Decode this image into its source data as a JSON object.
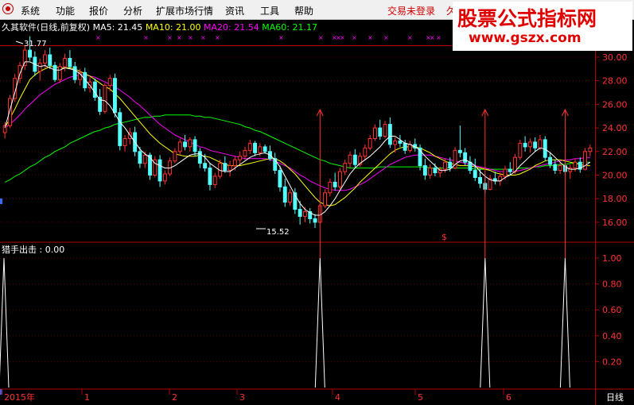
{
  "menu": {
    "items": [
      "系统",
      "功能",
      "报价",
      "分析",
      "扩展市场行情",
      "资讯",
      "工具",
      "帮助"
    ],
    "status": "交易未登录",
    "status_extra": "久"
  },
  "watermark": {
    "title": "股票公式指标网",
    "url": "www.gszx.com"
  },
  "price_panel": {
    "name": "久其软件(日线,前复权)",
    "ma5": "MA5: 21.45",
    "ma10": "MA10: 21.00",
    "ma20": "MA20: 21.54",
    "ma60": "MA60: 21.17",
    "high_label": "31.77",
    "low_label": "15.52",
    "marker": "$",
    "y_ticks": [
      "30.00",
      "28.00",
      "26.00",
      "24.00",
      "22.00",
      "20.00",
      "18.00",
      "16.00"
    ],
    "colors": {
      "ma5": "#ffffff",
      "ma10": "#ffff00",
      "ma20": "#ff00ff",
      "ma60": "#00ff00",
      "up": "#ff3232",
      "down": "#54ffff",
      "signal": "#ff3232"
    }
  },
  "indicator_panel": {
    "title": "猎手出击 : 0.00",
    "y_ticks": [
      "1.00",
      "0.80",
      "0.60",
      "0.40",
      "0.20"
    ]
  },
  "time_axis": {
    "labels": [
      "2015年",
      "1",
      "2",
      "3",
      "4",
      "5",
      "6"
    ],
    "period": "日线"
  },
  "chart_data": {
    "type": "candlestick",
    "ylim": [
      15,
      31.5
    ],
    "candles": [
      [
        23.6,
        24.5,
        23.1,
        24.2
      ],
      [
        24.2,
        26.8,
        24.0,
        26.5
      ],
      [
        26.5,
        28.6,
        26.2,
        28.2
      ],
      [
        28.2,
        29.6,
        27.8,
        29.3
      ],
      [
        29.3,
        31.0,
        28.9,
        30.6
      ],
      [
        30.6,
        31.77,
        29.7,
        30.0
      ],
      [
        30.0,
        30.5,
        28.4,
        28.8
      ],
      [
        28.8,
        29.9,
        28.0,
        29.5
      ],
      [
        29.5,
        30.6,
        29.1,
        30.2
      ],
      [
        30.2,
        30.8,
        29.0,
        29.3
      ],
      [
        29.3,
        29.6,
        27.9,
        28.1
      ],
      [
        28.1,
        29.5,
        27.8,
        29.2
      ],
      [
        29.2,
        30.3,
        28.8,
        29.9
      ],
      [
        29.9,
        30.6,
        29.0,
        29.2
      ],
      [
        29.2,
        29.6,
        27.8,
        28.1
      ],
      [
        28.1,
        29.0,
        27.6,
        28.7
      ],
      [
        28.7,
        29.1,
        27.1,
        27.4
      ],
      [
        27.4,
        28.3,
        27.0,
        27.9
      ],
      [
        27.9,
        28.2,
        26.3,
        26.6
      ],
      [
        26.6,
        27.3,
        25.1,
        25.4
      ],
      [
        25.4,
        27.8,
        25.2,
        27.6
      ],
      [
        27.6,
        28.5,
        27.1,
        28.2
      ],
      [
        28.2,
        28.6,
        24.9,
        25.3
      ],
      [
        25.3,
        25.7,
        22.1,
        22.5
      ],
      [
        22.5,
        23.4,
        22.0,
        23.1
      ],
      [
        23.1,
        24.0,
        22.6,
        23.6
      ],
      [
        23.6,
        24.1,
        21.6,
        22.0
      ],
      [
        22.0,
        22.4,
        20.6,
        21.0
      ],
      [
        21.0,
        22.0,
        20.6,
        21.7
      ],
      [
        21.7,
        21.9,
        19.6,
        20.0
      ],
      [
        20.0,
        21.6,
        19.8,
        21.3
      ],
      [
        21.3,
        21.7,
        19.0,
        19.5
      ],
      [
        19.5,
        20.4,
        19.2,
        20.1
      ],
      [
        20.1,
        21.5,
        19.9,
        21.2
      ],
      [
        21.2,
        22.3,
        21.0,
        22.0
      ],
      [
        22.0,
        23.1,
        21.7,
        22.8
      ],
      [
        22.8,
        23.4,
        22.1,
        22.4
      ],
      [
        22.4,
        23.2,
        22.0,
        23.0
      ],
      [
        23.0,
        23.3,
        21.6,
        22.0
      ],
      [
        22.0,
        22.3,
        20.6,
        21.0
      ],
      [
        21.0,
        21.8,
        20.3,
        20.6
      ],
      [
        20.6,
        21.0,
        18.7,
        19.2
      ],
      [
        19.2,
        20.2,
        18.9,
        19.9
      ],
      [
        19.9,
        21.3,
        19.7,
        21.0
      ],
      [
        21.0,
        21.6,
        20.2,
        20.4
      ],
      [
        20.4,
        21.2,
        19.9,
        20.8
      ],
      [
        20.8,
        21.6,
        20.4,
        21.3
      ],
      [
        21.3,
        22.0,
        20.9,
        21.6
      ],
      [
        21.6,
        22.4,
        21.3,
        22.1
      ],
      [
        22.1,
        23.0,
        21.8,
        22.7
      ],
      [
        22.7,
        22.9,
        21.6,
        21.9
      ],
      [
        21.9,
        22.7,
        21.6,
        22.4
      ],
      [
        22.4,
        22.6,
        21.8,
        22.0
      ],
      [
        22.0,
        22.5,
        21.2,
        21.4
      ],
      [
        21.4,
        21.9,
        20.1,
        20.4
      ],
      [
        20.4,
        20.8,
        18.6,
        19.0
      ],
      [
        19.0,
        19.7,
        17.3,
        17.7
      ],
      [
        17.7,
        18.8,
        17.4,
        18.5
      ],
      [
        18.5,
        18.9,
        16.7,
        17.1
      ],
      [
        17.1,
        17.8,
        15.8,
        16.5
      ],
      [
        16.5,
        17.3,
        16.0,
        16.9
      ],
      [
        16.9,
        17.2,
        15.9,
        16.3
      ],
      [
        16.3,
        16.7,
        15.52,
        16.0
      ],
      [
        16.0,
        17.6,
        15.9,
        17.4
      ],
      [
        17.4,
        18.8,
        17.2,
        18.5
      ],
      [
        18.5,
        19.7,
        18.2,
        19.4
      ],
      [
        19.4,
        20.2,
        18.7,
        19.0
      ],
      [
        19.0,
        20.6,
        18.8,
        20.3
      ],
      [
        20.3,
        21.3,
        20.0,
        21.0
      ],
      [
        21.0,
        22.0,
        20.6,
        21.7
      ],
      [
        21.7,
        22.2,
        20.6,
        20.9
      ],
      [
        20.9,
        21.9,
        20.7,
        21.6
      ],
      [
        21.6,
        22.6,
        21.3,
        22.3
      ],
      [
        22.3,
        23.4,
        22.1,
        23.1
      ],
      [
        23.1,
        24.3,
        22.9,
        24.0
      ],
      [
        24.0,
        24.7,
        23.0,
        23.3
      ],
      [
        23.3,
        24.6,
        23.1,
        24.3
      ],
      [
        24.3,
        24.9,
        22.3,
        22.6
      ],
      [
        22.6,
        23.2,
        21.9,
        22.9
      ],
      [
        22.9,
        23.4,
        22.4,
        22.7
      ],
      [
        22.7,
        23.0,
        21.8,
        22.1
      ],
      [
        22.1,
        22.9,
        21.9,
        22.6
      ],
      [
        22.6,
        23.1,
        22.0,
        22.3
      ],
      [
        22.3,
        22.6,
        20.4,
        20.8
      ],
      [
        20.8,
        21.4,
        19.6,
        20.0
      ],
      [
        20.0,
        20.9,
        19.7,
        20.6
      ],
      [
        20.6,
        21.0,
        19.9,
        20.2
      ],
      [
        20.2,
        20.7,
        19.8,
        20.5
      ],
      [
        20.5,
        21.4,
        20.2,
        21.1
      ],
      [
        21.1,
        21.5,
        20.3,
        20.6
      ],
      [
        20.6,
        22.4,
        20.5,
        22.1
      ],
      [
        22.1,
        24.2,
        21.5,
        21.9
      ],
      [
        21.9,
        22.3,
        20.8,
        21.1
      ],
      [
        21.1,
        21.6,
        20.1,
        20.4
      ],
      [
        20.4,
        21.4,
        19.5,
        19.8
      ],
      [
        19.8,
        20.5,
        18.9,
        19.3
      ],
      [
        19.3,
        20.1,
        18.5,
        18.8
      ],
      [
        18.8,
        20.0,
        18.7,
        19.7
      ],
      [
        19.7,
        20.3,
        19.2,
        19.5
      ],
      [
        19.5,
        20.2,
        19.1,
        19.9
      ],
      [
        19.9,
        20.8,
        19.6,
        20.5
      ],
      [
        20.5,
        21.1,
        20.0,
        20.3
      ],
      [
        20.3,
        21.8,
        20.1,
        21.5
      ],
      [
        21.5,
        23.0,
        21.3,
        22.7
      ],
      [
        22.7,
        23.3,
        22.0,
        22.4
      ],
      [
        22.4,
        23.1,
        21.9,
        22.8
      ],
      [
        22.8,
        23.2,
        22.0,
        22.3
      ],
      [
        22.3,
        23.4,
        22.1,
        23.0
      ],
      [
        23.0,
        23.3,
        21.2,
        21.5
      ],
      [
        21.5,
        21.9,
        20.6,
        20.9
      ],
      [
        20.9,
        21.3,
        20.1,
        20.4
      ],
      [
        20.4,
        21.1,
        20.1,
        20.8
      ],
      [
        20.8,
        21.2,
        20.0,
        20.3
      ],
      [
        20.3,
        20.9,
        19.7,
        20.6
      ],
      [
        20.6,
        21.4,
        20.3,
        21.1
      ],
      [
        21.1,
        21.5,
        20.2,
        20.5
      ],
      [
        20.5,
        22.3,
        20.4,
        22.0
      ],
      [
        22.0,
        22.6,
        21.6,
        22.3
      ]
    ],
    "ma_series": [
      {
        "name": "MA5",
        "values": [
          24.0,
          25.5,
          27.0,
          28.6,
          29.6,
          29.6,
          29.4,
          29.2,
          29.3,
          29.1,
          28.9,
          28.9,
          29.1,
          29.0,
          28.9,
          28.6,
          28.1,
          27.6,
          27.0,
          26.4,
          26.3,
          25.9,
          25.2,
          24.5,
          24.0,
          23.4,
          22.8,
          22.2,
          21.8,
          21.5,
          21.0,
          20.8,
          20.6,
          20.6,
          20.8,
          21.1,
          21.4,
          21.7,
          21.8,
          21.8,
          21.5,
          21.0,
          20.7,
          20.4,
          20.3,
          20.3,
          20.6,
          20.9,
          21.2,
          21.5,
          21.7,
          21.8,
          21.9,
          21.7,
          21.3,
          20.7,
          19.9,
          19.1,
          18.3,
          17.6,
          17.1,
          16.8,
          16.6,
          16.6,
          16.9,
          17.4,
          18.0,
          18.7,
          19.4,
          20.1,
          20.6,
          21.0,
          21.3,
          21.6,
          22.0,
          22.4,
          22.9,
          23.3,
          23.3,
          23.0,
          22.7,
          22.6,
          22.4,
          22.1,
          21.6,
          21.2,
          20.8,
          20.4,
          20.4,
          20.5,
          20.9,
          21.2,
          21.3,
          21.1,
          20.8,
          20.3,
          19.9,
          19.6,
          19.5,
          19.5,
          19.8,
          20.0,
          20.3,
          20.8,
          21.2,
          21.6,
          22.0,
          22.3,
          22.2,
          21.9,
          21.5,
          21.1,
          20.7,
          20.5,
          20.5,
          20.6,
          20.8,
          21.1
        ]
      },
      {
        "name": "MA10",
        "values": [
          24.0,
          24.8,
          25.6,
          26.5,
          27.3,
          28.1,
          28.5,
          28.8,
          29.0,
          29.2,
          29.2,
          29.1,
          29.1,
          29.1,
          29.0,
          28.8,
          28.6,
          28.4,
          28.1,
          27.8,
          27.5,
          27.3,
          26.9,
          26.5,
          26.0,
          25.5,
          25.0,
          24.5,
          24.0,
          23.5,
          23.1,
          22.7,
          22.4,
          22.1,
          21.8,
          21.7,
          21.6,
          21.6,
          21.6,
          21.7,
          21.6,
          21.5,
          21.3,
          21.1,
          20.9,
          20.8,
          20.8,
          20.8,
          20.9,
          21.0,
          21.1,
          21.2,
          21.3,
          21.4,
          21.4,
          21.2,
          20.9,
          20.5,
          20.1,
          19.6,
          19.1,
          18.6,
          18.1,
          17.7,
          17.5,
          17.4,
          17.5,
          17.8,
          18.1,
          18.5,
          18.9,
          19.4,
          19.8,
          20.2,
          20.6,
          21.0,
          21.4,
          21.8,
          22.1,
          22.3,
          22.4,
          22.4,
          22.4,
          22.3,
          22.1,
          21.9,
          21.6,
          21.4,
          21.2,
          21.0,
          20.9,
          20.8,
          20.8,
          20.8,
          20.7,
          20.6,
          20.5,
          20.4,
          20.2,
          20.1,
          20.0,
          20.0,
          20.0,
          20.1,
          20.3,
          20.5,
          20.8,
          21.0,
          21.2,
          21.3,
          21.3,
          21.3,
          21.2,
          21.1,
          21.0,
          20.9,
          20.8,
          20.8
        ]
      },
      {
        "name": "MA20",
        "values": [
          24.0,
          24.3,
          24.7,
          25.1,
          25.6,
          26.0,
          26.4,
          26.8,
          27.1,
          27.4,
          27.7,
          27.9,
          28.1,
          28.3,
          28.4,
          28.5,
          28.5,
          28.4,
          28.3,
          28.1,
          27.9,
          27.7,
          27.5,
          27.2,
          26.9,
          26.6,
          26.2,
          25.9,
          25.5,
          25.1,
          24.7,
          24.3,
          24.0,
          23.7,
          23.4,
          23.2,
          23.0,
          22.8,
          22.6,
          22.4,
          22.3,
          22.1,
          22.0,
          21.9,
          21.8,
          21.7,
          21.6,
          21.5,
          21.4,
          21.4,
          21.4,
          21.4,
          21.4,
          21.3,
          21.2,
          21.0,
          20.8,
          20.6,
          20.3,
          20.0,
          19.8,
          19.5,
          19.3,
          19.1,
          18.9,
          18.8,
          18.7,
          18.7,
          18.7,
          18.8,
          19.0,
          19.2,
          19.4,
          19.7,
          20.0,
          20.3,
          20.6,
          20.9,
          21.1,
          21.3,
          21.5,
          21.6,
          21.7,
          21.7,
          21.7,
          21.7,
          21.6,
          21.5,
          21.4,
          21.3,
          21.2,
          21.1,
          21.0,
          20.9,
          20.8,
          20.7,
          20.6,
          20.5,
          20.4,
          20.3,
          20.3,
          20.3,
          20.3,
          20.4,
          20.5,
          20.6,
          20.7,
          20.8,
          20.9,
          21.0,
          21.1,
          21.2,
          21.3,
          21.3,
          21.4,
          21.4,
          21.5,
          21.5
        ]
      },
      {
        "name": "MA60",
        "values": [
          19.4,
          19.6,
          19.9,
          20.1,
          20.4,
          20.7,
          20.9,
          21.2,
          21.5,
          21.7,
          22.0,
          22.2,
          22.4,
          22.7,
          22.9,
          23.1,
          23.3,
          23.5,
          23.7,
          23.8,
          24.0,
          24.1,
          24.3,
          24.4,
          24.5,
          24.6,
          24.7,
          24.8,
          24.9,
          24.9,
          25.0,
          25.0,
          25.1,
          25.1,
          25.1,
          25.1,
          25.1,
          25.1,
          25.0,
          25.0,
          24.9,
          24.9,
          24.8,
          24.7,
          24.6,
          24.5,
          24.4,
          24.3,
          24.1,
          24.0,
          23.8,
          23.7,
          23.5,
          23.3,
          23.1,
          22.9,
          22.7,
          22.5,
          22.3,
          22.1,
          21.9,
          21.7,
          21.5,
          21.3,
          21.2,
          21.0,
          20.9,
          20.8,
          20.7,
          20.6,
          20.6,
          20.6,
          20.6,
          20.6,
          20.6,
          20.7,
          20.7,
          20.7,
          20.7,
          20.7,
          20.7,
          20.7,
          20.7,
          20.7,
          20.7,
          20.6,
          20.6,
          20.6,
          20.6,
          20.6,
          20.6,
          20.6,
          20.6,
          20.6,
          20.5,
          20.5,
          20.5,
          20.5,
          20.5,
          20.5,
          20.5,
          20.5,
          20.5,
          20.6,
          20.6,
          20.6,
          20.7,
          20.7,
          20.8,
          20.8,
          20.8,
          20.9,
          20.9,
          21.0,
          21.0,
          21.0,
          21.1,
          21.1
        ]
      }
    ],
    "indicator": {
      "name": "猎手出击",
      "value": 0.0,
      "ylim": [
        0,
        1
      ],
      "signal_index": [
        0,
        63,
        96,
        112,
        131
      ]
    }
  }
}
